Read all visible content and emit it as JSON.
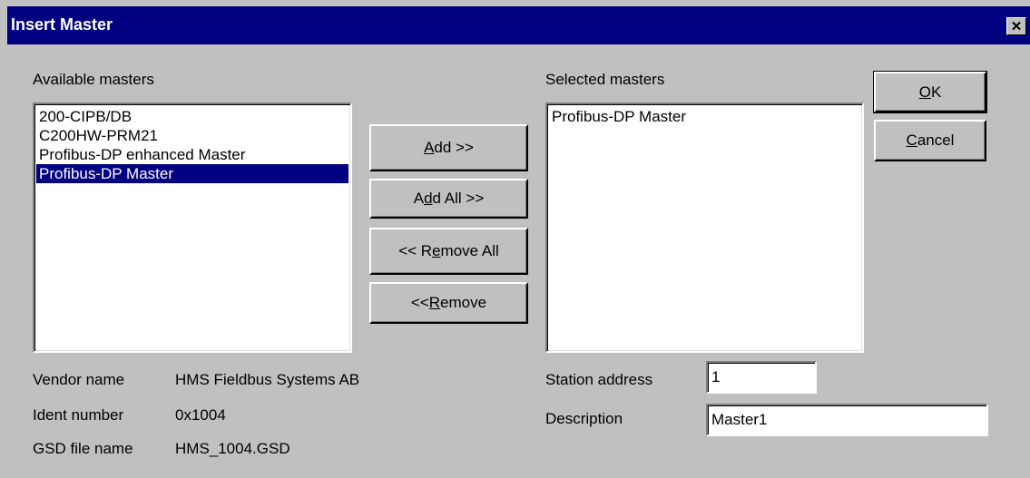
{
  "window": {
    "title": "Insert Master",
    "close_symbol": "✕"
  },
  "available": {
    "label": "Available masters",
    "items": [
      "200-CIPB/DB",
      "C200HW-PRM21",
      "Profibus-DP enhanced Master",
      "Profibus-DP Master"
    ],
    "selected_index": 3
  },
  "selected": {
    "label": "Selected masters",
    "items": [
      "Profibus-DP Master"
    ]
  },
  "buttons": {
    "add": {
      "pre": "",
      "u": "A",
      "post": "dd >>"
    },
    "add_all": {
      "pre": "A",
      "u": "d",
      "post": "d All >>"
    },
    "remove_all": {
      "pre": "<< R",
      "u": "e",
      "post": "move All"
    },
    "remove": {
      "pre": "<< ",
      "u": "R",
      "post": "emove"
    },
    "ok": {
      "pre": "",
      "u": "O",
      "post": "K"
    },
    "cancel": {
      "pre": "",
      "u": "C",
      "post": "ancel"
    }
  },
  "info": {
    "vendor_label": "Vendor name",
    "vendor_value": "HMS Fieldbus Systems AB",
    "ident_label": "Ident number",
    "ident_value": "0x1004",
    "gsd_label": "GSD file name",
    "gsd_value": "HMS_1004.GSD"
  },
  "fields": {
    "station_label": "Station address",
    "station_value": "1",
    "description_label": "Description",
    "description_value": "Master1"
  },
  "colors": {
    "titlebar": "#000080",
    "dialog": "#c0c0c0",
    "selection": "#000080"
  }
}
